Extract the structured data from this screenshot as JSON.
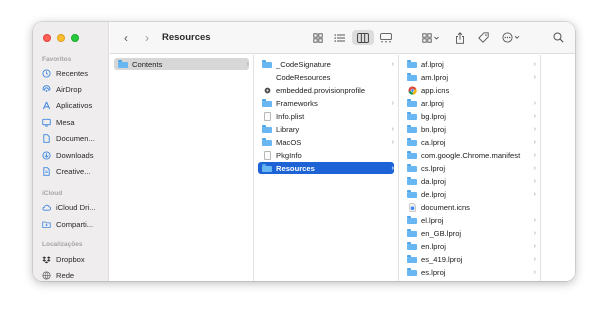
{
  "toolbar": {
    "title": "Resources",
    "back": "‹",
    "forward": "›"
  },
  "sidebar": {
    "favorites_label": "Favoritos",
    "icloud_label": "iCloud",
    "locations_label": "Localizações",
    "favorites": [
      {
        "label": "Recentes",
        "icon": "clock-icon"
      },
      {
        "label": "AirDrop",
        "icon": "airdrop-icon"
      },
      {
        "label": "Aplicativos",
        "icon": "apps-icon"
      },
      {
        "label": "Mesa",
        "icon": "desktop-icon"
      },
      {
        "label": "Documen...",
        "icon": "document-icon"
      },
      {
        "label": "Downloads",
        "icon": "download-icon"
      },
      {
        "label": "Creative...",
        "icon": "file-icon"
      }
    ],
    "icloud": [
      {
        "label": "iCloud Dri...",
        "icon": "cloud-icon"
      },
      {
        "label": "Comparti...",
        "icon": "shared-folder-icon"
      }
    ],
    "locations": [
      {
        "label": "Dropbox",
        "icon": "dropbox-icon"
      },
      {
        "label": "Rede",
        "icon": "network-icon"
      }
    ]
  },
  "columns": {
    "col1": [
      {
        "name": "Contents",
        "type": "folder",
        "chevron": "›"
      }
    ],
    "col2": [
      {
        "name": "_CodeSignature",
        "type": "folder",
        "chevron": "›"
      },
      {
        "name": "CodeResources",
        "type": "blank",
        "chevron": ""
      },
      {
        "name": "embedded.provisionprofile",
        "type": "dot",
        "chevron": ""
      },
      {
        "name": "Frameworks",
        "type": "folder",
        "chevron": "›"
      },
      {
        "name": "Info.plist",
        "type": "doc",
        "chevron": ""
      },
      {
        "name": "Library",
        "type": "folder",
        "chevron": "›"
      },
      {
        "name": "MacOS",
        "type": "folder",
        "chevron": "›"
      },
      {
        "name": "PkgInfo",
        "type": "doc",
        "chevron": ""
      },
      {
        "name": "Resources",
        "type": "folder",
        "chevron": "›"
      }
    ],
    "col3": [
      {
        "name": "af.lproj",
        "type": "folder",
        "chevron": "›"
      },
      {
        "name": "am.lproj",
        "type": "folder",
        "chevron": "›"
      },
      {
        "name": "app.icns",
        "type": "chrome",
        "chevron": ""
      },
      {
        "name": "ar.lproj",
        "type": "folder",
        "chevron": "›"
      },
      {
        "name": "bg.lproj",
        "type": "folder",
        "chevron": "›"
      },
      {
        "name": "bn.lproj",
        "type": "folder",
        "chevron": "›"
      },
      {
        "name": "ca.lproj",
        "type": "folder",
        "chevron": "›"
      },
      {
        "name": "com.google.Chrome.manifest",
        "type": "folder",
        "chevron": "›"
      },
      {
        "name": "cs.lproj",
        "type": "folder",
        "chevron": "›"
      },
      {
        "name": "da.lproj",
        "type": "folder",
        "chevron": "›"
      },
      {
        "name": "de.lproj",
        "type": "folder",
        "chevron": "›"
      },
      {
        "name": "document.icns",
        "type": "icns",
        "chevron": ""
      },
      {
        "name": "el.lproj",
        "type": "folder",
        "chevron": "›"
      },
      {
        "name": "en_GB.lproj",
        "type": "folder",
        "chevron": "›"
      },
      {
        "name": "en.lproj",
        "type": "folder",
        "chevron": "›"
      },
      {
        "name": "es_419.lproj",
        "type": "folder",
        "chevron": "›"
      },
      {
        "name": "es.lproj",
        "type": "folder",
        "chevron": "›"
      }
    ]
  }
}
